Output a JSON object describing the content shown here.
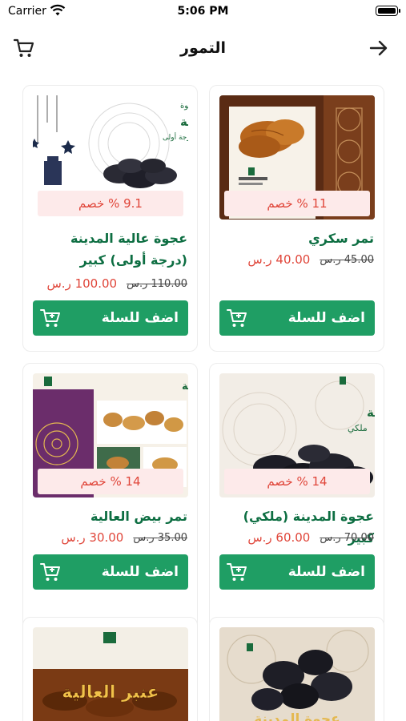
{
  "status_bar": {
    "carrier": "Carrier",
    "time": "5:06 PM"
  },
  "nav": {
    "title": "التمور",
    "cart_icon": "cart-icon",
    "back_icon": "arrow-right-icon"
  },
  "products": [
    {
      "name": "تمر سكري",
      "discount": "11 % خصم",
      "old_price": "45.00 ر.س",
      "new_price": "40.00 ر.س",
      "add_label": "اضف للسلة"
    },
    {
      "name": "عجوة عالية المدينة (درجة أولى) كبير",
      "discount": "9.1 % خصم",
      "old_price": "110.00 ر.س",
      "new_price": "100.00 ر.س",
      "add_label": "اضف للسلة",
      "image_text": [
        "عجوة",
        "عالية المدينة",
        "درجة أولى"
      ]
    },
    {
      "name": "عجوة المدينة (ملكي) كبير",
      "discount": "14 % خصم",
      "old_price": "70.00 ر.س",
      "new_price": "60.00 ر.س",
      "add_label": "اضف للسلة",
      "image_text": [
        "عجوة المدينة",
        "ملكي"
      ]
    },
    {
      "name": "تمر بيض العالية",
      "discount": "14 % خصم",
      "old_price": "35.00 ر.س",
      "new_price": "30.00 ر.س",
      "add_label": "اضف للسلة",
      "image_text": [
        "تمر بيض العالية"
      ]
    },
    {
      "image_text": [
        "عجوة المدينة"
      ]
    },
    {
      "image_text": [
        "عنبر العالية"
      ]
    }
  ],
  "colors": {
    "accent": "#1f9e64",
    "title_green": "#0d6e42",
    "discount_bg": "#fdeaea",
    "price_red": "#e0463a"
  }
}
